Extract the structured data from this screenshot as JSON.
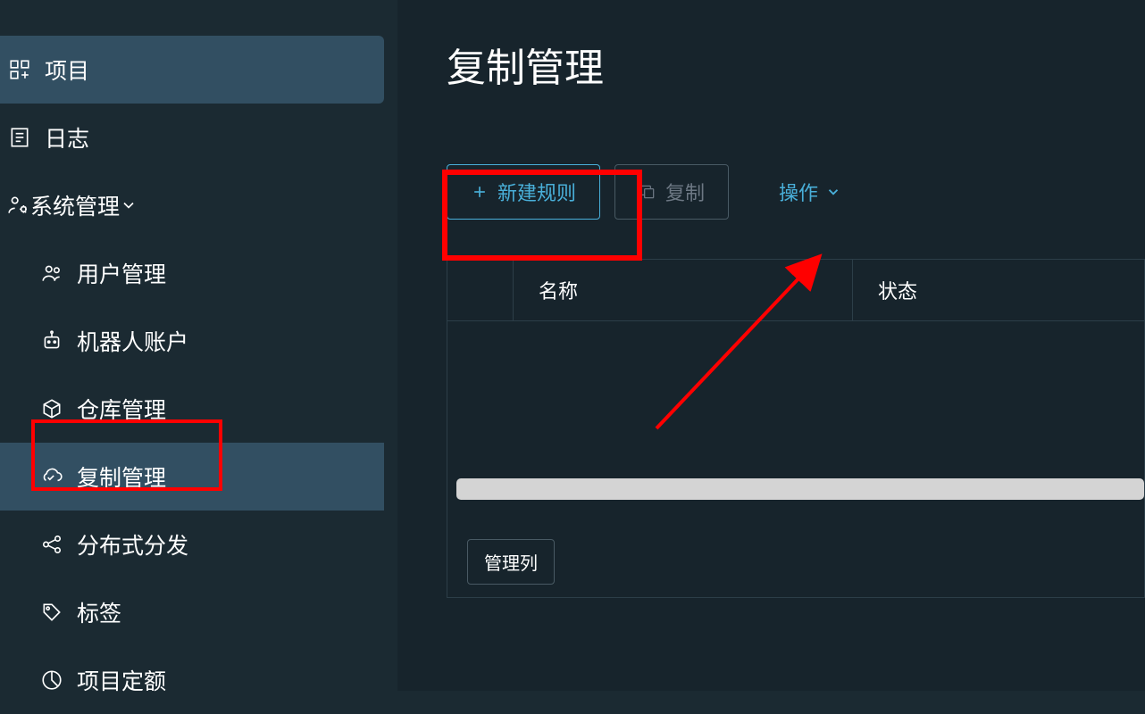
{
  "sidebar": {
    "projects": "项目",
    "logs": "日志",
    "system_admin": "系统管理",
    "items": {
      "user_mgmt": "用户管理",
      "robot_accounts": "机器人账户",
      "repo_mgmt": "仓库管理",
      "replication_mgmt": "复制管理",
      "distribution": "分布式分发",
      "tags": "标签",
      "project_quota": "项目定额"
    }
  },
  "main": {
    "title": "复制管理",
    "toolbar": {
      "new_rule": "新建规则",
      "copy": "复制",
      "action": "操作"
    },
    "table": {
      "header_name": "名称",
      "header_status": "状态",
      "manage_columns": "管理列"
    }
  }
}
